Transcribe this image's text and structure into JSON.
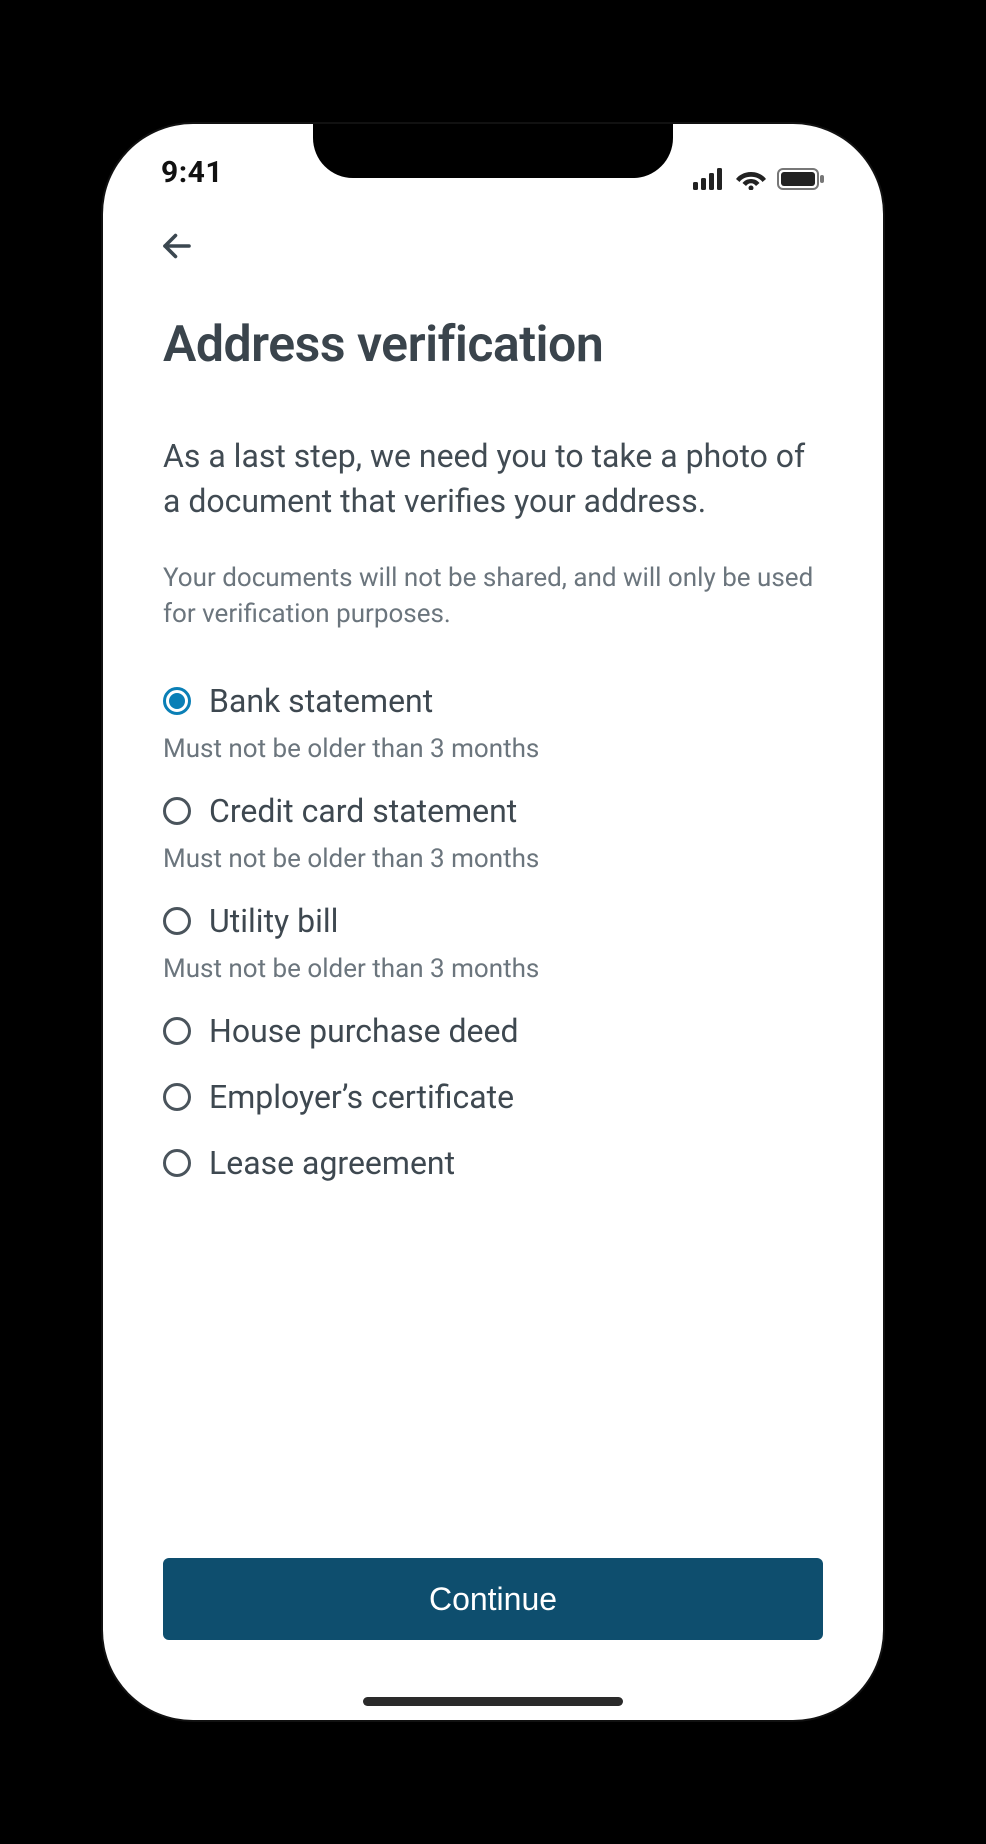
{
  "status": {
    "time": "9:41"
  },
  "header": {
    "title": "Address verification"
  },
  "body": {
    "subtitle": "As a last step, we need you to take a photo of a document that verifies your address.",
    "privacy": "Your documents will not be shared, and will only be used for verification purposes."
  },
  "options": [
    {
      "label": "Bank statement",
      "hint": "Must not be older than 3 months",
      "selected": true
    },
    {
      "label": "Credit card statement",
      "hint": "Must not be older than 3 months",
      "selected": false
    },
    {
      "label": "Utility bill",
      "hint": "Must not be older than 3 months",
      "selected": false
    },
    {
      "label": "House purchase deed",
      "hint": "",
      "selected": false
    },
    {
      "label": "Employer’s certificate",
      "hint": "",
      "selected": false
    },
    {
      "label": "Lease agreement",
      "hint": "",
      "selected": false
    }
  ],
  "cta": {
    "label": "Continue"
  }
}
